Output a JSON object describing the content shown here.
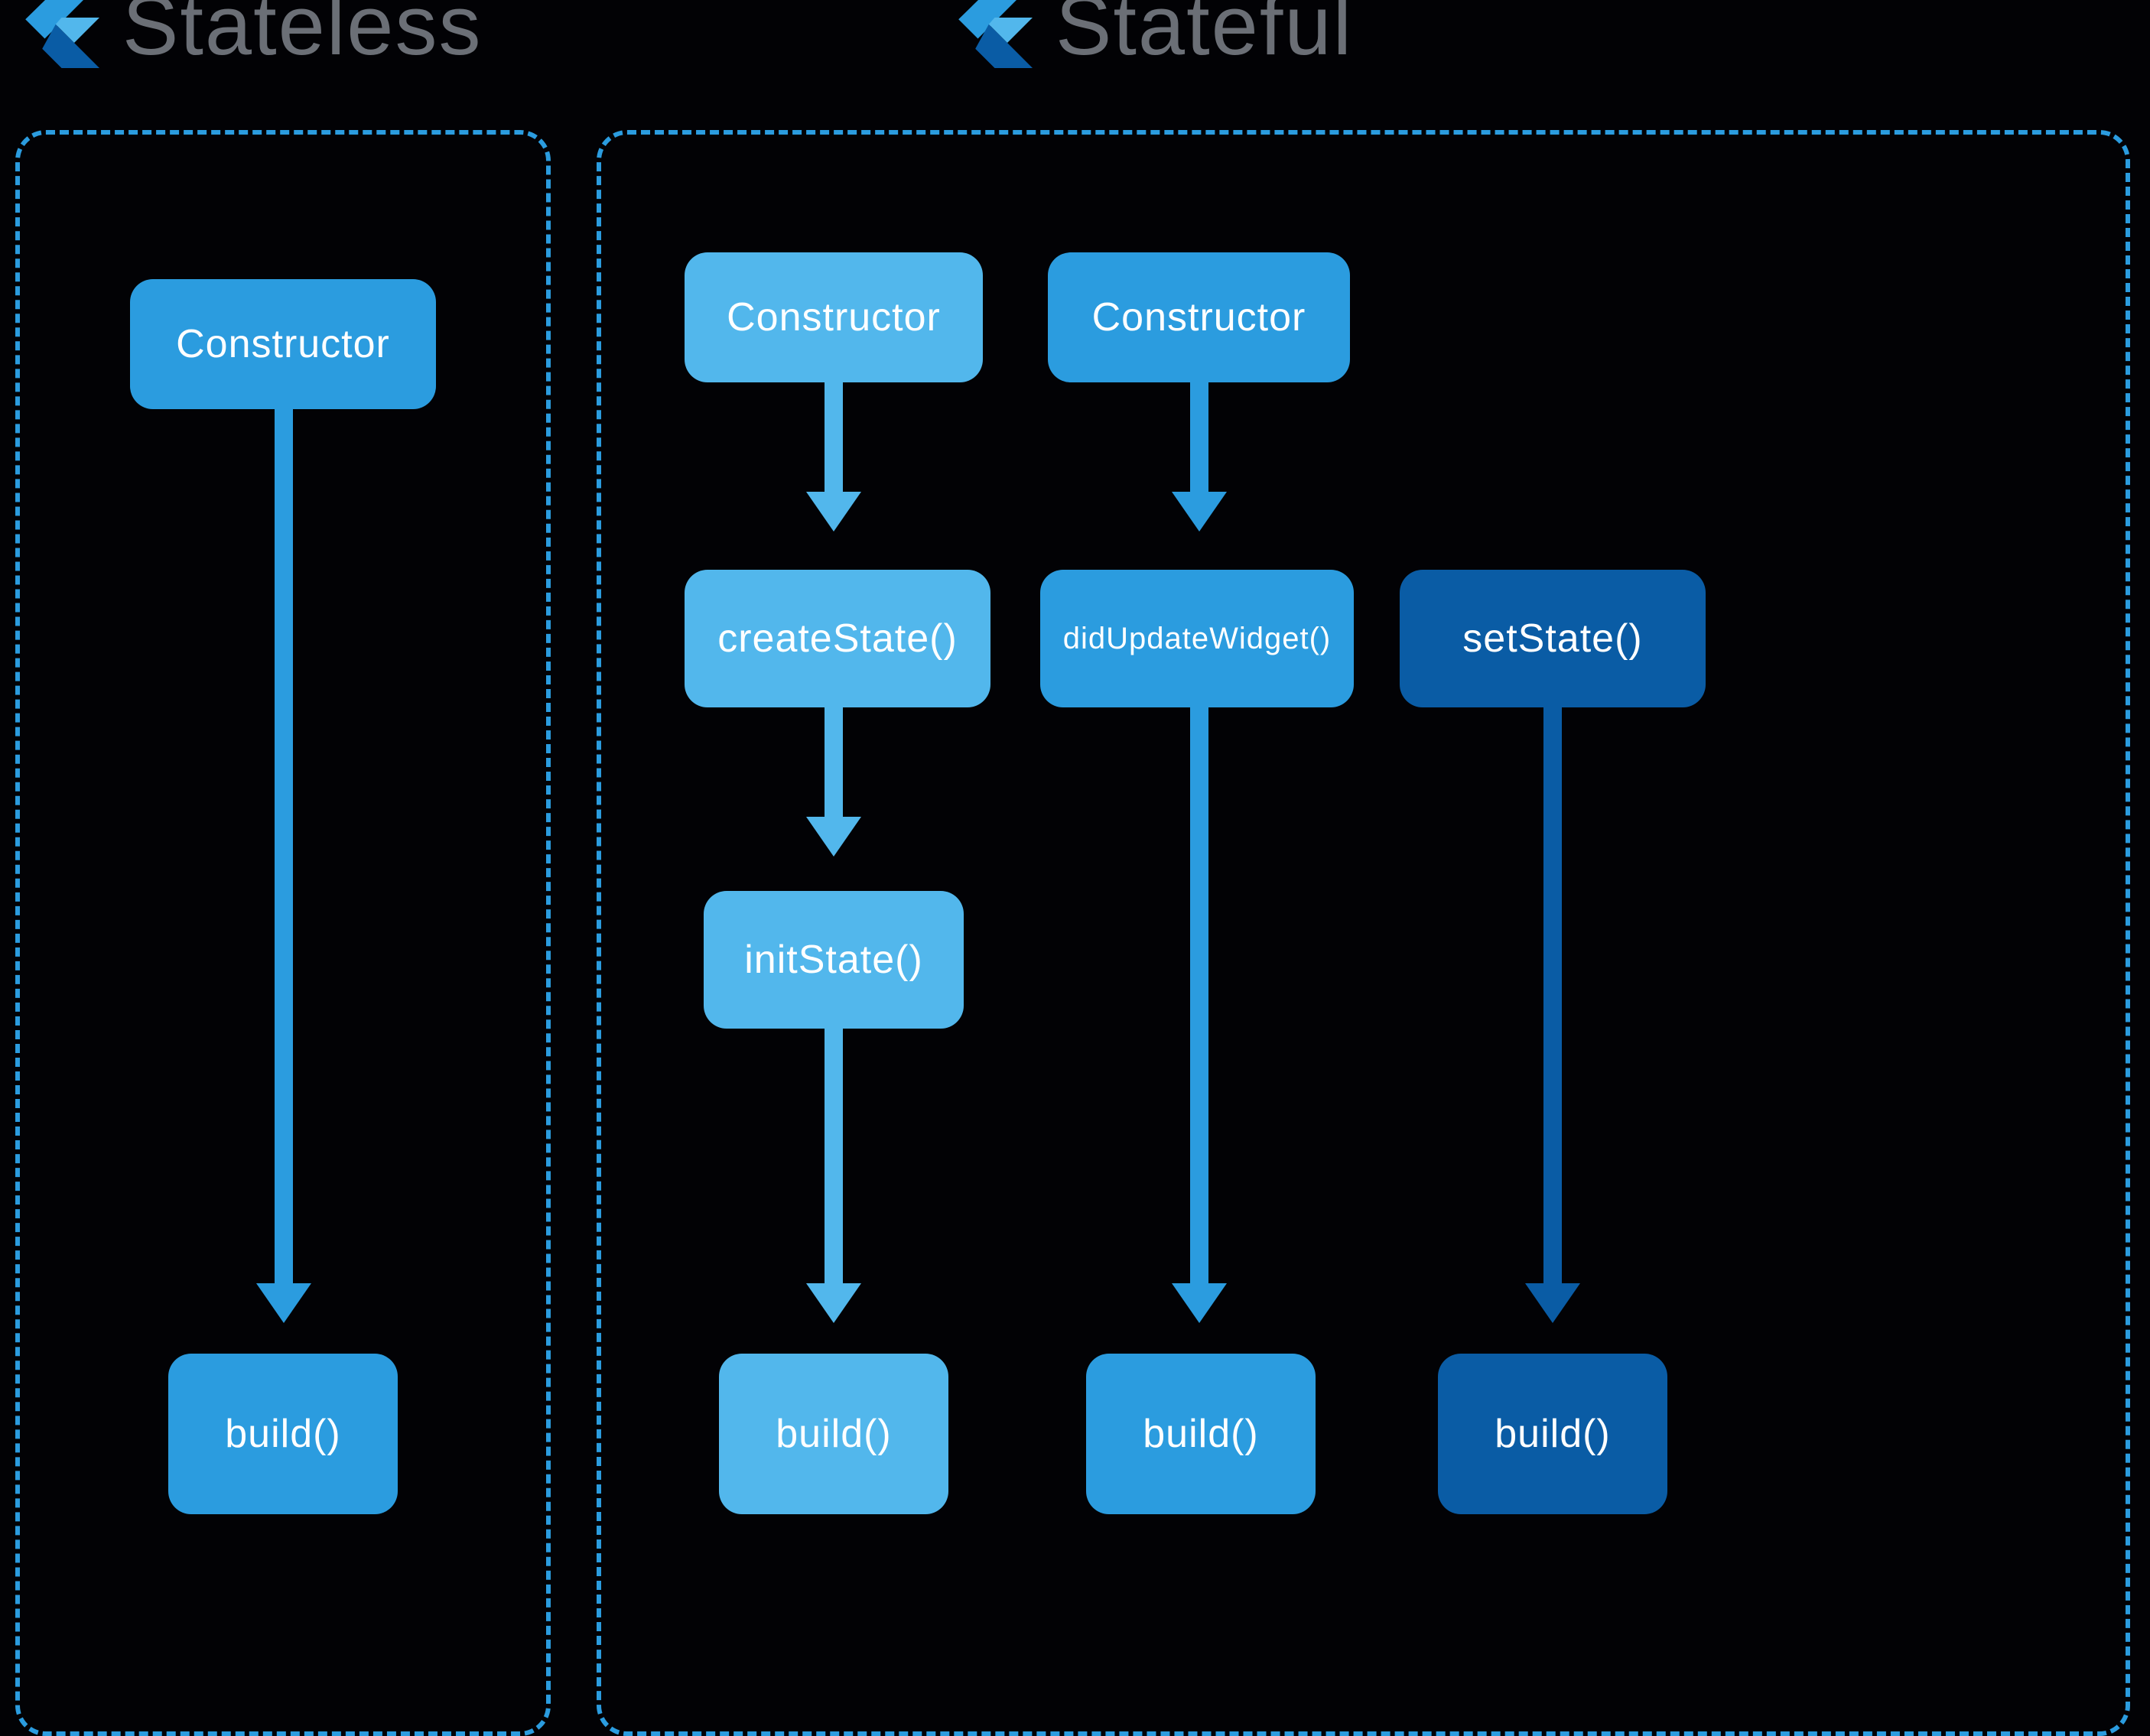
{
  "titles": {
    "stateless": "Stateless",
    "stateful": "Stateful"
  },
  "colors": {
    "light": "#52b7ec",
    "medium": "#2b9cdf",
    "dark": "#0a5ca5",
    "title": "#6b6f76",
    "bg": "#020205"
  },
  "nodes": {
    "sl_constructor": "Constructor",
    "sl_build": "build()",
    "sf_constructor1": "Constructor",
    "sf_createState": "createState()",
    "sf_initState": "initState()",
    "sf_build1": "build()",
    "sf_constructor2": "Constructor",
    "sf_didUpdate": "didUpdateWidget()",
    "sf_build2": "build()",
    "sf_setState": "setState()",
    "sf_build3": "build()"
  },
  "diagram": {
    "panels": [
      {
        "id": "stateless",
        "title": "Stateless",
        "border_color": "medium",
        "tracks": [
          {
            "color": "medium",
            "steps": [
              "Constructor",
              "build()"
            ]
          }
        ]
      },
      {
        "id": "stateful",
        "title": "Stateful",
        "border_color": "medium",
        "tracks": [
          {
            "color": "light",
            "steps": [
              "Constructor",
              "createState()",
              "initState()",
              "build()"
            ]
          },
          {
            "color": "medium",
            "steps": [
              "Constructor",
              "didUpdateWidget()",
              "build()"
            ]
          },
          {
            "color": "dark",
            "steps": [
              "setState()",
              "build()"
            ]
          }
        ]
      }
    ],
    "arrows": [
      {
        "from": "sl_constructor",
        "to": "sl_build",
        "color": "medium"
      },
      {
        "from": "sf_constructor1",
        "to": "sf_createState",
        "color": "light"
      },
      {
        "from": "sf_createState",
        "to": "sf_initState",
        "color": "light"
      },
      {
        "from": "sf_initState",
        "to": "sf_build1",
        "color": "light"
      },
      {
        "from": "sf_constructor2",
        "to": "sf_didUpdate",
        "color": "medium"
      },
      {
        "from": "sf_didUpdate",
        "to": "sf_build2",
        "color": "medium"
      },
      {
        "from": "sf_setState",
        "to": "sf_build3",
        "color": "dark"
      }
    ]
  }
}
